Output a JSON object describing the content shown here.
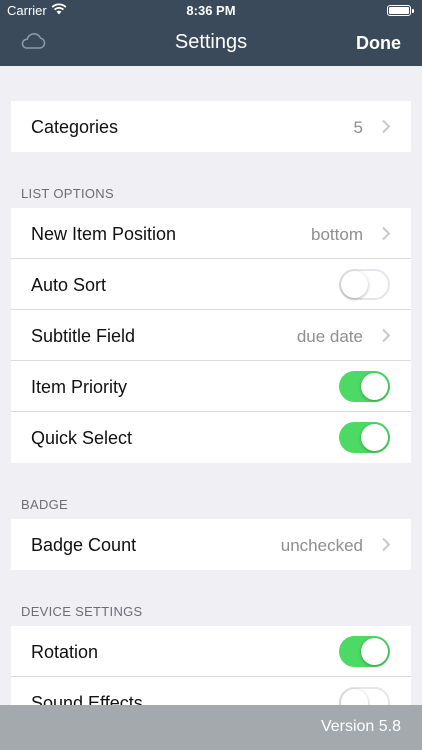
{
  "status_bar": {
    "carrier": "Carrier",
    "time": "8:36 PM"
  },
  "nav": {
    "title": "Settings",
    "done_label": "Done",
    "left_icon": "cloud-icon"
  },
  "groups": {
    "main": {
      "categories_label": "Categories",
      "categories_value": "5"
    },
    "list_options": {
      "header": "LIST OPTIONS",
      "new_item_position_label": "New Item Position",
      "new_item_position_value": "bottom",
      "auto_sort_label": "Auto Sort",
      "auto_sort_on": false,
      "subtitle_field_label": "Subtitle Field",
      "subtitle_field_value": "due date",
      "item_priority_label": "Item Priority",
      "item_priority_on": true,
      "quick_select_label": "Quick Select",
      "quick_select_on": true
    },
    "badge": {
      "header": "BADGE",
      "badge_count_label": "Badge Count",
      "badge_count_value": "unchecked"
    },
    "device_settings": {
      "header": "DEVICE SETTINGS",
      "rotation_label": "Rotation",
      "rotation_on": true,
      "sound_effects_label": "Sound Effects",
      "sound_effects_on": false
    }
  },
  "footer": {
    "version": "Version 5.8"
  },
  "colors": {
    "nav_bar": "#3a4a5a",
    "toggle_on": "#4cd964",
    "footer": "#a4a9ad",
    "background": "#efeff4"
  }
}
